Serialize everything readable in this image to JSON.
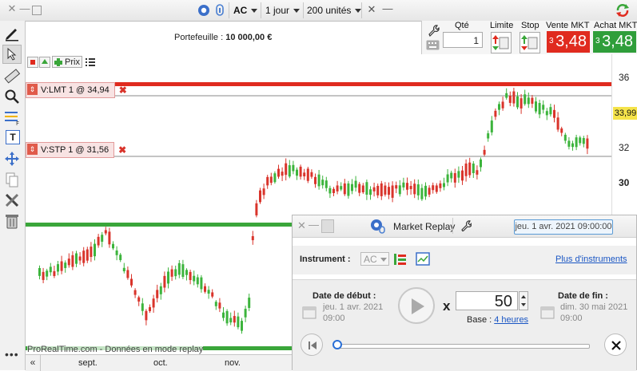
{
  "toolbar": {
    "instrument": "AC",
    "period": "1 jour",
    "units": "200 unités"
  },
  "portfolio": {
    "label": "Portefeuille : ",
    "value": "10 000,00 €"
  },
  "order_panel": {
    "qty_label": "Qté",
    "qty_value": "1",
    "limit_label": "Limite",
    "stop_label": "Stop",
    "sell_label": "Vente MKT",
    "buy_label": "Achat MKT",
    "sell_price": "3,48",
    "buy_price": "3,48",
    "sell_qty_prefix": "3",
    "buy_qty_prefix": "3"
  },
  "chart_header": {
    "price_label": "Prix"
  },
  "orders": {
    "limit_order": "V:LMT  1 @ 34,94",
    "stop_order": "V:STP  1 @ 31,56"
  },
  "y_axis": {
    "ticks": [
      "36",
      "34",
      "32",
      "30"
    ],
    "current_price": "33,99"
  },
  "x_axis": {
    "ticks": [
      "sept.",
      "oct.",
      "nov."
    ]
  },
  "watermark": "ProRealTime.com - Données en mode replay",
  "replay": {
    "title": "Market Replay",
    "current_date": "jeu. 1 avr. 2021 09:00:00",
    "instrument_label": "Instrument :",
    "instrument_value": "AC",
    "more_instruments": "Plus d'instruments",
    "start_label": "Date de début :",
    "start_date": "jeu. 1 avr. 2021",
    "start_time": "09:00",
    "multiplier_label": "x",
    "speed": "50",
    "base_label": "Base : ",
    "base_value": "4 heures",
    "end_label": "Date de fin :",
    "end_date": "dim. 30 mai 2021",
    "end_time": "09:00"
  },
  "colors": {
    "accent_red": "#e02b1f",
    "accent_green": "#3aa63a",
    "bull_candle": "#3cb43c",
    "bear_candle": "#d9342b",
    "link_blue": "#1a56c4",
    "highlight_yellow": "#f5e34a"
  },
  "icons": {
    "back": "chevron-left-icon",
    "close": "close-icon",
    "settings": "wrench-icon",
    "play": "play-icon"
  }
}
